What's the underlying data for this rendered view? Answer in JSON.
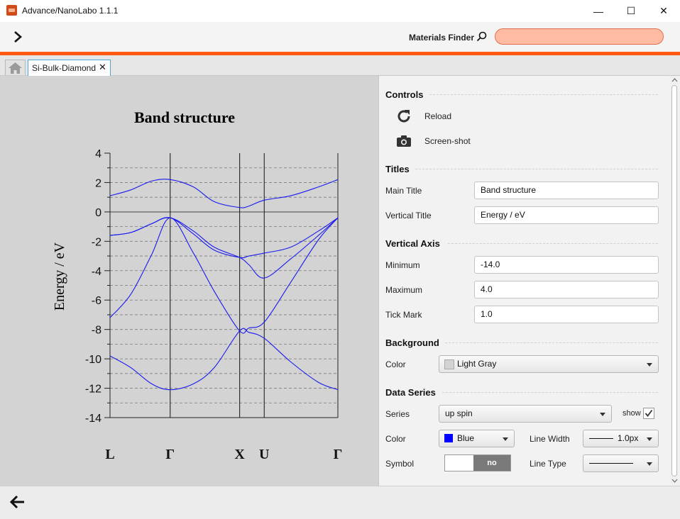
{
  "window": {
    "title": "Advance/NanoLabo 1.1.1",
    "minimize": "—",
    "maximize": "☐",
    "close": "✕"
  },
  "header": {
    "finder_label": "Materials Finder",
    "search_value": ""
  },
  "tabs": {
    "active_label": "Si-Bulk-Diamond",
    "close_glyph": "✕"
  },
  "chart_data": {
    "type": "line",
    "title": "Band structure",
    "ylabel": "Energy / eV",
    "xlabel": "",
    "ylim": [
      -14,
      4
    ],
    "major_ticks": [
      4,
      2,
      0,
      -2,
      -4,
      -6,
      -8,
      -10,
      -12,
      -14
    ],
    "y_tick_labels": [
      "4",
      "2",
      "0",
      "-2",
      "-4",
      "-6",
      "-8",
      "-10",
      "-12",
      "-14"
    ],
    "minor_tick_step": 1,
    "grid": true,
    "zero_line": true,
    "k_points": [
      {
        "label": "L",
        "x": 0
      },
      {
        "label": "Γ",
        "x": 0.866
      },
      {
        "label": "X",
        "x": 1.866
      },
      {
        "label": "U",
        "x": 2.22
      },
      {
        "label": "Γ",
        "x": 3.28
      }
    ],
    "x_range": [
      0,
      3.28
    ],
    "series_color": "#1a1af0",
    "series": [
      {
        "x": [
          0,
          0.3,
          0.6,
          0.866,
          1.2,
          1.5,
          1.866,
          2.0,
          2.22,
          2.6,
          3.0,
          3.28
        ],
        "values": [
          -9.8,
          -10.6,
          -11.7,
          -12.1,
          -11.7,
          -10.6,
          -8.1,
          -8.2,
          -8.6,
          -10.2,
          -11.6,
          -12.1
        ]
      },
      {
        "x": [
          0,
          0.3,
          0.6,
          0.866,
          1.2,
          1.5,
          1.866,
          2.0,
          2.22,
          2.6,
          3.0,
          3.28
        ],
        "values": [
          -7.2,
          -5.6,
          -2.9,
          -0.4,
          -2.8,
          -5.4,
          -8.1,
          -7.9,
          -7.5,
          -4.8,
          -1.9,
          -0.4
        ]
      },
      {
        "x": [
          0,
          0.3,
          0.6,
          0.866,
          1.2,
          1.5,
          1.866,
          2.0,
          2.22,
          2.6,
          3.0,
          3.28
        ],
        "values": [
          -1.6,
          -1.4,
          -0.8,
          -0.4,
          -1.3,
          -2.4,
          -3.1,
          -3.6,
          -4.5,
          -3.2,
          -1.6,
          -0.4
        ]
      },
      {
        "x": [
          0,
          0.3,
          0.6,
          0.866,
          1.2,
          1.5,
          1.866,
          2.0,
          2.22,
          2.6,
          3.0,
          3.28
        ],
        "values": [
          -1.6,
          -1.4,
          -0.8,
          -0.4,
          -1.5,
          -2.6,
          -3.1,
          -3.0,
          -2.8,
          -2.4,
          -1.3,
          -0.4
        ]
      },
      {
        "x": [
          0,
          0.3,
          0.6,
          0.866,
          1.2,
          1.5,
          1.866,
          2.0,
          2.22,
          2.6,
          3.0,
          3.28
        ],
        "values": [
          1.1,
          1.5,
          2.1,
          2.2,
          1.7,
          0.7,
          0.3,
          0.4,
          0.8,
          1.1,
          1.7,
          2.2
        ]
      }
    ]
  },
  "controls": {
    "section_controls": "Controls",
    "reload_label": "Reload",
    "screenshot_label": "Screen-shot",
    "section_titles": "Titles",
    "main_title_label": "Main Title",
    "main_title_value": "Band structure",
    "vertical_title_label": "Vertical Title",
    "vertical_title_value": "Energy / eV",
    "section_axis": "Vertical Axis",
    "minimum_label": "Minimum",
    "minimum_value": "-14.0",
    "maximum_label": "Maximum",
    "maximum_value": "4.0",
    "tick_label": "Tick Mark",
    "tick_value": "1.0",
    "section_background": "Background",
    "bg_color_label": "Color",
    "bg_color_value": "Light Gray",
    "bg_swatch": "#d3d3d3",
    "section_series": "Data Series",
    "series_label": "Series",
    "series_value": "up spin",
    "show_label": "show",
    "show_checked": true,
    "series_color_label": "Color",
    "series_color_value": "Blue",
    "series_swatch": "#0000ff",
    "line_width_label": "Line Width",
    "line_width_value": "1.0px",
    "symbol_label": "Symbol",
    "symbol_toggle": "no",
    "line_type_label": "Line Type"
  }
}
